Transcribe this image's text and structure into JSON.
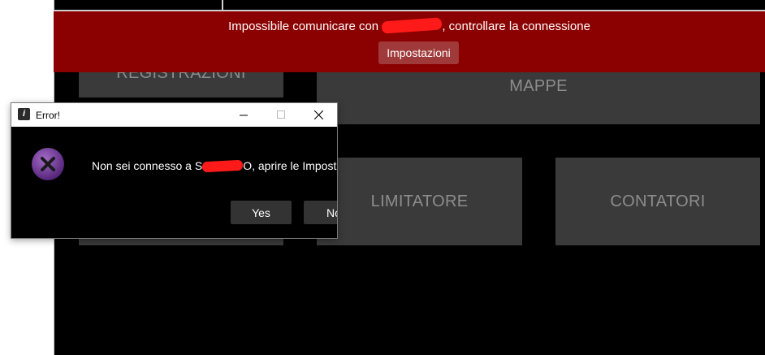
{
  "app": {
    "tiles": {
      "registrazioni": "REGISTRAZIONI",
      "mappe": "MAPPE",
      "limitatore": "LIMITATORE",
      "contatori": "CONTATORI"
    }
  },
  "banner": {
    "message_before": "Impossibile comunicare con",
    "message_after": ", controllare la connessione",
    "button_label": "Impostazioni",
    "background": "#8b0000"
  },
  "dialog": {
    "title": "Error!",
    "icon": "error-x-icon",
    "message_before": "Non sei connesso a S",
    "message_after": "O, aprire le Impostaz",
    "yes_label": "Yes",
    "no_label": "No"
  }
}
